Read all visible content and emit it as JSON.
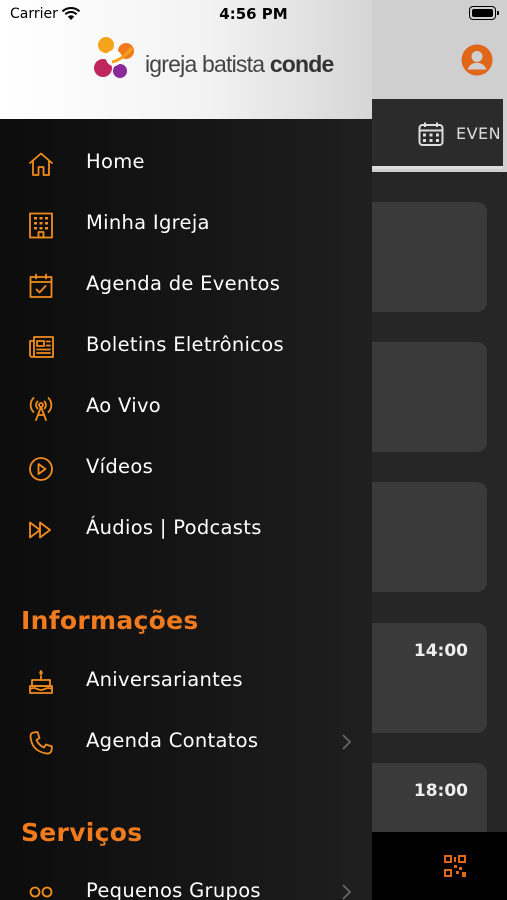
{
  "status_bar": {
    "carrier": "Carrier",
    "time": "4:56 PM"
  },
  "logo": {
    "text_light": "igreja batista ",
    "text_bold": "conde"
  },
  "background": {
    "tab_label": "EVEN",
    "card_times": [
      "14:00",
      "18:00"
    ]
  },
  "menu": {
    "items": [
      {
        "label": "Home",
        "icon": "home-icon"
      },
      {
        "label": "Minha Igreja",
        "icon": "building-icon"
      },
      {
        "label": "Agenda de Eventos",
        "icon": "calendar-check-icon"
      },
      {
        "label": "Boletins Eletrônicos",
        "icon": "newspaper-icon"
      },
      {
        "label": "Ao Vivo",
        "icon": "broadcast-icon"
      },
      {
        "label": "Vídeos",
        "icon": "play-circle-icon"
      },
      {
        "label": "Áudios | Podcasts",
        "icon": "fast-forward-icon"
      }
    ],
    "info_section": "Informações",
    "info_items": [
      {
        "label": "Aniversariantes",
        "icon": "cake-icon"
      },
      {
        "label": "Agenda Contatos",
        "icon": "phone-icon"
      }
    ],
    "services_section": "Serviços",
    "services_items": [
      {
        "label": "Pequenos Grupos",
        "icon": "group-icon"
      }
    ]
  },
  "colors": {
    "accent": "#f07a1e",
    "drawer_bg": "#141414",
    "card_bg": "#3a3a3a"
  }
}
